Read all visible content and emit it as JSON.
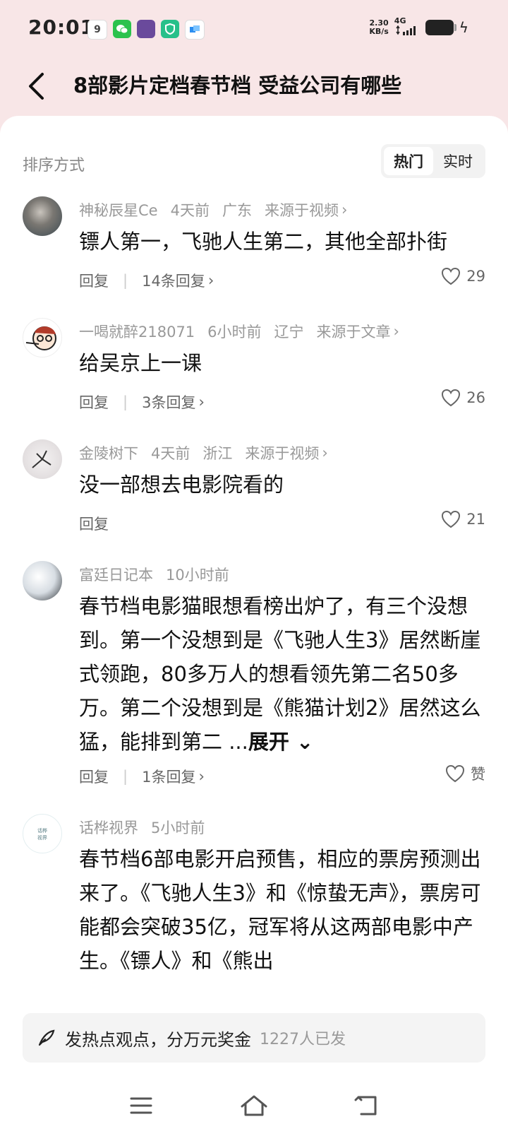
{
  "status_bar": {
    "time": "20:01",
    "speed_value": "2.30",
    "speed_unit": "KB/s",
    "network": "4G",
    "icons": [
      "notification-icon",
      "wechat-icon",
      "app-icon",
      "shield-icon",
      "message-icon"
    ]
  },
  "header": {
    "title": "8部影片定档春节档 受益公司有哪些"
  },
  "sort": {
    "label": "排序方式",
    "options": [
      {
        "label": "热门",
        "active": true
      },
      {
        "label": "实时",
        "active": false
      }
    ]
  },
  "comments": [
    {
      "user": "神秘辰星Ce",
      "time": "4天前",
      "location": "广东",
      "source": "来源于视频",
      "text": "镖人第一，飞驰人生第二，其他全部扑街",
      "reply_label": "回复",
      "replies": "14条回复",
      "likes": "29"
    },
    {
      "user": "一喝就醉218071",
      "time": "6小时前",
      "location": "辽宁",
      "source": "来源于文章",
      "text": "给吴京上一课",
      "reply_label": "回复",
      "replies": "3条回复",
      "likes": "26"
    },
    {
      "user": "金陵树下",
      "time": "4天前",
      "location": "浙江",
      "source": "来源于视频",
      "text": "没一部想去电影院看的",
      "reply_label": "回复",
      "replies": "",
      "likes": "21"
    },
    {
      "user": "富廷日记本",
      "time": "10小时前",
      "location": "",
      "source": "",
      "text": "春节档电影猫眼想看榜出炉了，有三个没想到。第一个没想到是《飞驰人生3》居然断崖式领跑，80多万人的想看领先第二名50多万。第二个没想到是《熊猫计划2》居然这么猛，能排到第二 ...",
      "expand": "展开",
      "reply_label": "回复",
      "replies": "1条回复",
      "likes": "赞"
    },
    {
      "user": "话桦视界",
      "time": "5小时前",
      "location": "",
      "source": "",
      "text": "春节档6部电影开启预售，相应的票房预测出来了。《飞驰人生3》和《惊蛰无声》，票房可能都会突破35亿，冠军将从这两部电影中产生。《镖人》和《熊出",
      "avatar_text": "话桦视界"
    }
  ],
  "post_bar": {
    "text": "发热点观点，分万元奖金",
    "count": "1227人已发"
  },
  "colors": {
    "header_bg": "#f8e6e7",
    "meta_gray": "#999999"
  }
}
